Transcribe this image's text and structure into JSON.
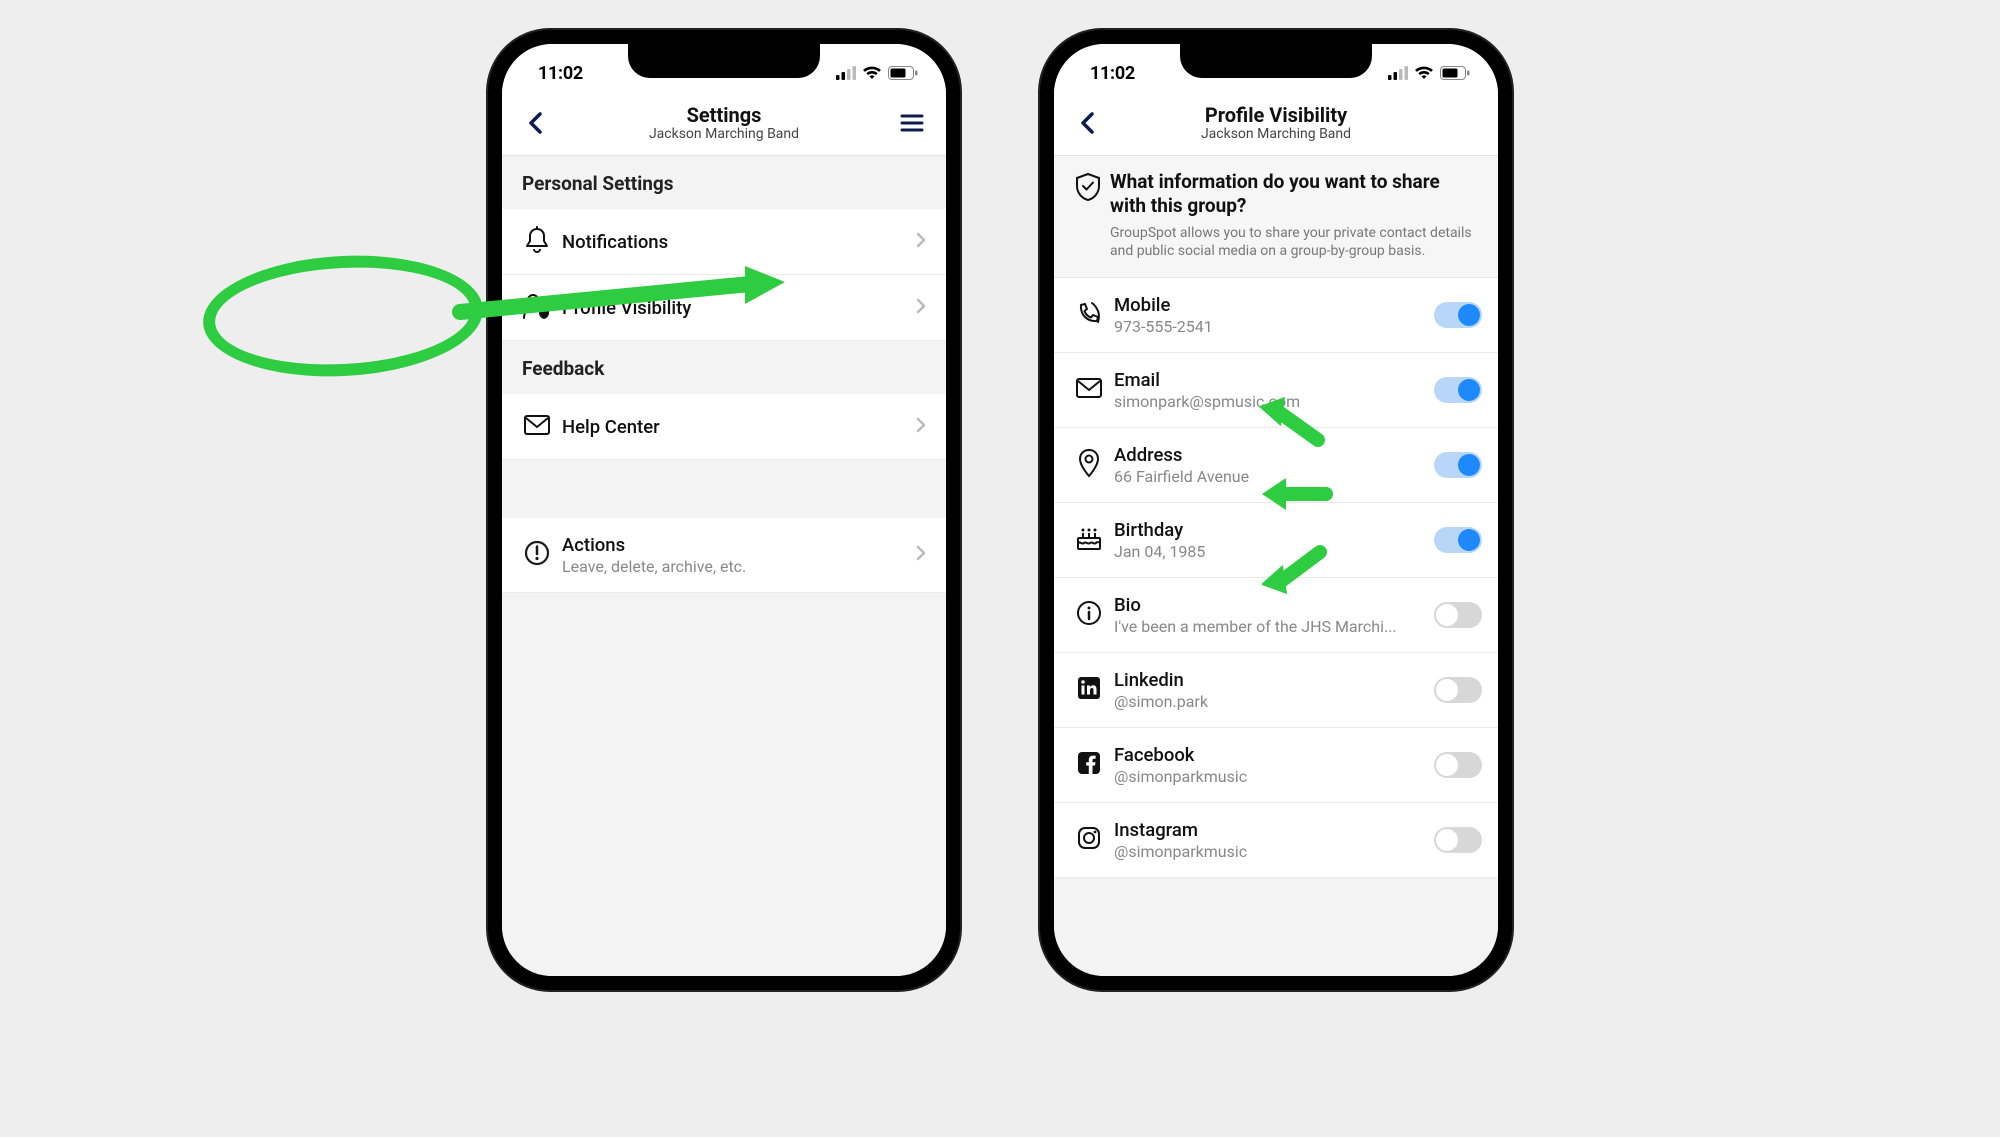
{
  "status": {
    "time": "11:02"
  },
  "left": {
    "nav": {
      "title": "Settings",
      "subtitle": "Jackson Marching Band"
    },
    "sections": {
      "personal_label": "Personal Settings",
      "feedback_label": "Feedback"
    },
    "rows": {
      "notifications": {
        "label": "Notifications"
      },
      "profile_visibility": {
        "label": "Profile Visibility"
      },
      "help_center": {
        "label": "Help Center"
      },
      "actions": {
        "label": "Actions",
        "sub": "Leave, delete, archive, etc."
      }
    }
  },
  "right": {
    "nav": {
      "title": "Profile Visibility",
      "subtitle": "Jackson Marching Band"
    },
    "header": {
      "question": "What information do you want to share with this group?",
      "desc": "GroupSpot allows you to share your private contact details and public social media on a group-by-group basis."
    },
    "items": {
      "mobile": {
        "label": "Mobile",
        "value": "973-555-2541",
        "on": true
      },
      "email": {
        "label": "Email",
        "value": "simonpark@spmusic.com",
        "on": true
      },
      "address": {
        "label": "Address",
        "value": "66 Fairfield Avenue",
        "on": true
      },
      "birthday": {
        "label": "Birthday",
        "value": "Jan 04, 1985",
        "on": true
      },
      "bio": {
        "label": "Bio",
        "value": "I've been a member of the JHS Marchi...",
        "on": false
      },
      "linkedin": {
        "label": "Linkedin",
        "value": "@simon.park",
        "on": false
      },
      "facebook": {
        "label": "Facebook",
        "value": "@simonparkmusic",
        "on": false
      },
      "instagram": {
        "label": "Instagram",
        "value": "@simonparkmusic",
        "on": false
      }
    }
  },
  "icons": {
    "bell": "bell-icon",
    "person_shield": "person-shield-icon",
    "envelope": "envelope-icon",
    "warning": "warning-icon",
    "phone": "phone-icon",
    "map_pin": "map-pin-icon",
    "cake": "birthday-icon",
    "info": "info-icon",
    "linkedin": "linkedin-icon",
    "facebook": "facebook-icon",
    "instagram": "instagram-icon",
    "shield_check": "shield-check-icon"
  },
  "colors": {
    "accent": "#1e88ff",
    "annotation": "#2ecc40",
    "nav_tint": "#0a1b4f"
  }
}
